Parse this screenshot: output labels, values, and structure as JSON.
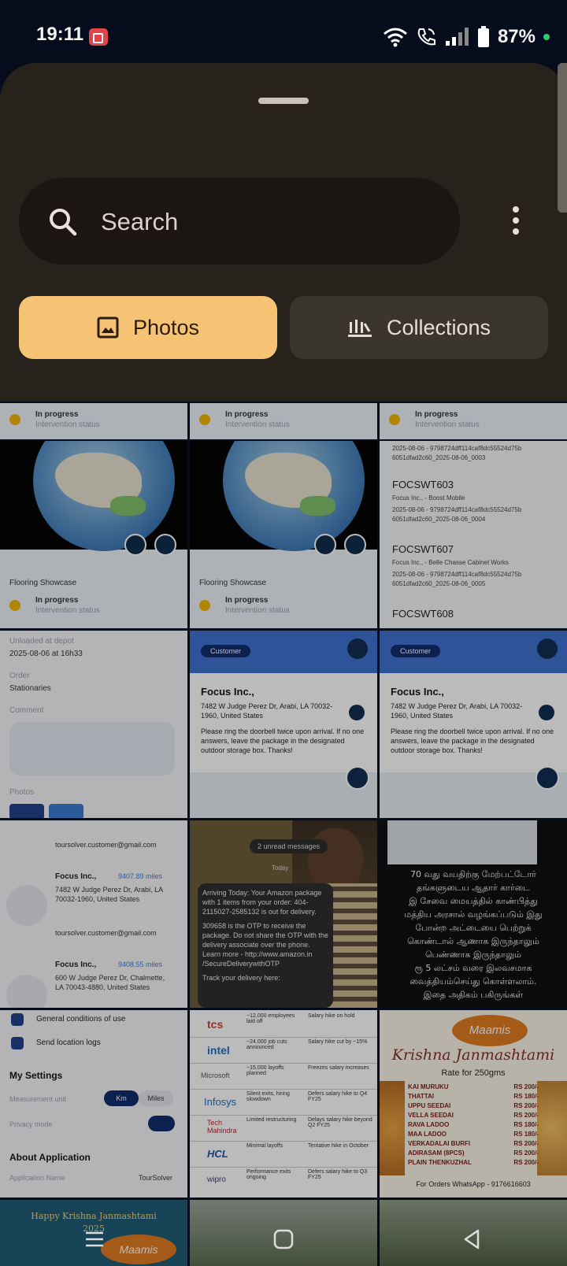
{
  "status_bar": {
    "time": "19:11",
    "battery": "87%"
  },
  "search": {
    "placeholder": "Search"
  },
  "tabs": [
    {
      "label": "Photos"
    },
    {
      "label": "Collections"
    }
  ],
  "thumbs": {
    "t1": {
      "status": "In progress",
      "sub": "Intervention status",
      "title": "Flooring Showcase"
    },
    "t3": {
      "top": "2025-08-06 - 9798724dff114caf8dc55524d75b 6051dfad2c60_2025-08-06_0003",
      "items": [
        {
          "code": "FOCSWT603",
          "company": "Focus Inc., - Boost Mobile",
          "ref": "2025-08-06 - 9798724dff114caf8dc55524d75b 6051dfad2c60_2025-08-06_0004"
        },
        {
          "code": "FOCSWT607",
          "company": "Focus Inc., - Belle Chasse Cabinet Works",
          "ref": "2025-08-06 - 9798724dff114caf8dc55524d75b 6051dfad2c60_2025-08-06_0005"
        },
        {
          "code": "FOCSWT608"
        }
      ]
    },
    "t4": {
      "l1": "Unloaded at depot",
      "v1": "2025-08-06 at 16h33",
      "l2": "Order",
      "v2": "Stationaries",
      "l3": "Comment",
      "l4": "Photos"
    },
    "t5": {
      "badge": "Customer",
      "name": "Focus Inc.,",
      "address": "7482 W Judge Perez Dr, Arabi, LA 70032-1960, United States",
      "note": "Please ring the doorbell twice upon arrival. If no one answers, leave the package in the designated outdoor storage box. Thanks!"
    },
    "t7": {
      "email": "toursolver.customer@gmail.com",
      "a_name": "Focus Inc.,",
      "a_dist": "9407.89 miles",
      "a_addr": "7482 W Judge Perez Dr, Arabi, LA 70032-1960, United States",
      "b_name": "Focus Inc.,",
      "b_dist": "9408.55 miles",
      "b_addr": "600 W Judge Perez Dr, Chalmette, LA 70043-4880, United States"
    },
    "t8": {
      "unread": "2 unread messages",
      "today": "Today",
      "msg1": "Arriving Today: Your Amazon package with 1 items from your order: 404-2115027-2585132 is out for delivery.",
      "msg2": "309658 is the OTP to receive the package. Do not share the OTP with the delivery associate over the phone. Learn more - http://www.amazon.in /SecureDeliverywithOTP",
      "msg3": "Track your delivery here:"
    },
    "t9": {
      "lines": [
        "70 வது வயதிற்கு மேற்பட்டோர்",
        "தங்களுடைய ஆதார் கார்டை",
        "இ சேவை மையத்தில் காண்பித்து",
        "மத்திய அரசால் வழங்கப்படும் இது",
        "போன்ற அட்டையை பெற்றுக்",
        "கொண்டால் ஆணாக இருந்தாலும்",
        "பெண்ணாக இருந்தாலும்",
        "ரூ 5 லட்சம் வரை இலவசமாக",
        "வைத்தியம்செய்து கொள்ளலாம்.",
        "இதை அதிகம் பகிருங்கள்"
      ]
    },
    "t10": {
      "row1": "General conditions of use",
      "row2": "Send location logs",
      "h1": "My Settings",
      "unit_label": "Measurement unit",
      "km": "Km",
      "miles": "Miles",
      "privacy": "Privacy mode",
      "h2": "About Application",
      "app_label": "Application Name",
      "app_name": "TourSolver"
    },
    "t11": {
      "rows": [
        {
          "co": "tcs",
          "a": "~12,000 employees laid off",
          "b": "Salary hike on hold"
        },
        {
          "co": "intel",
          "a": "~24,000 job cuts announced",
          "b": "Salary hike cut by ~15%"
        },
        {
          "co": "Microsoft",
          "a": "~15,000 layoffs planned",
          "b": "Freezes salary increases"
        },
        {
          "co": "Infosys",
          "a": "Silent exits, hiring slowdown",
          "b": "Defers salary hike to Q4 FY25"
        },
        {
          "co": "Tech Mahindra",
          "a": "Limited restructuring",
          "b": "Delays salary hike beyond Q2 FY25"
        },
        {
          "co": "HCL",
          "a": "Minimal layoffs",
          "b": "Tentative hike in October"
        },
        {
          "co": "wipro",
          "a": "Performance exits ongoing",
          "b": "Defers salary hike to Q3 FY25"
        }
      ]
    },
    "t12": {
      "brand": "Maamis",
      "title": "Krishna Janmashtami",
      "rate": "Rate for 250gms",
      "items": [
        {
          "n": "KAI MURUKU",
          "p": "RS 200/-"
        },
        {
          "n": "THATTAI",
          "p": "RS 180/-"
        },
        {
          "n": "UPPU SEEDAI",
          "p": "RS 200/-"
        },
        {
          "n": "VELLA SEEDAI",
          "p": "RS 200/-"
        },
        {
          "n": "RAVA LADOO",
          "p": "RS 180/-"
        },
        {
          "n": "MAA LADOO",
          "p": "RS 180/-"
        },
        {
          "n": "VERKADALAI BURFI",
          "p": "RS 200/-"
        },
        {
          "n": "ADIRASAM (8PCS)",
          "p": "RS 200/-"
        },
        {
          "n": "PLAIN THENKUZHAL",
          "p": "RS 200/-"
        }
      ],
      "footer": "For Orders WhatsApp - 9176616603"
    },
    "t13": {
      "title": "Happy Krishna Janmashtami",
      "year": "2025",
      "brand": "Maamis"
    }
  },
  "colors": {
    "accent": "#f6c274",
    "sheet": "#28221d",
    "status_bg": "#050d1c"
  }
}
